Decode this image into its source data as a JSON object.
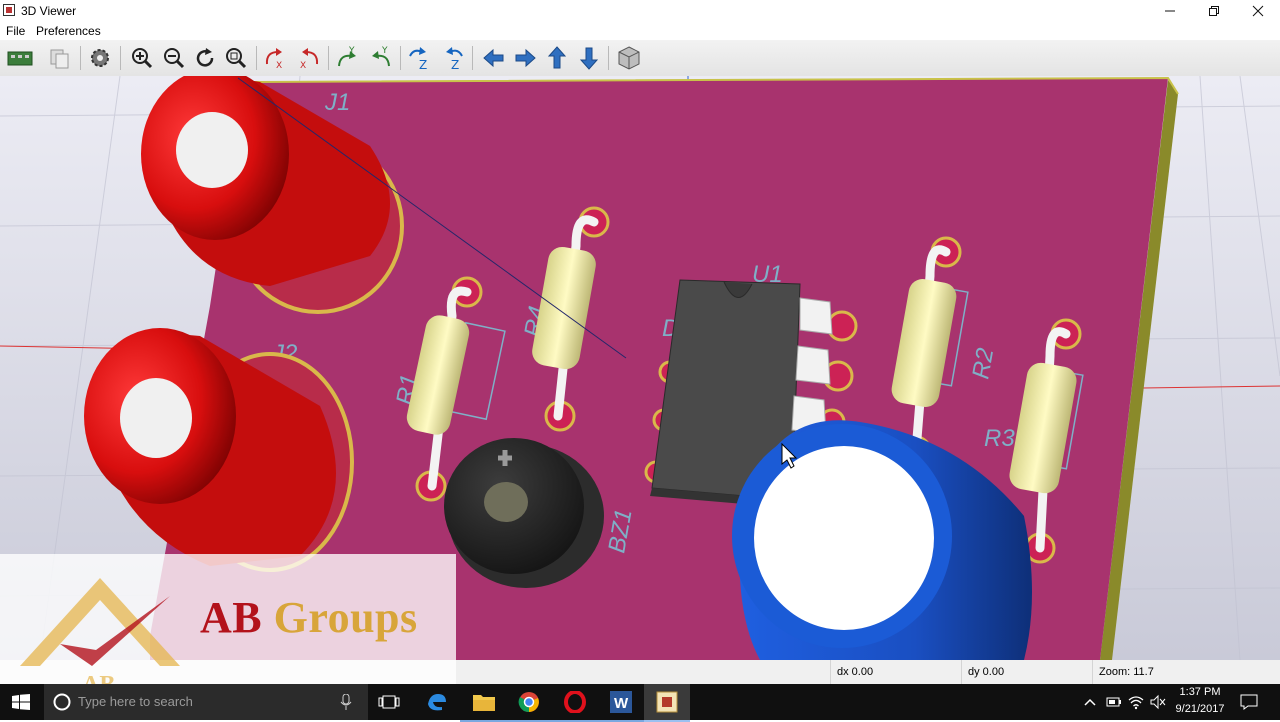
{
  "window": {
    "title": "3D Viewer"
  },
  "menu": {
    "items": [
      "File",
      "Preferences"
    ]
  },
  "toolbar": {
    "buttons": [
      "reload-board",
      "copy-to-clipboard",
      "settings",
      "zoom-in",
      "zoom-out",
      "redraw",
      "zoom-fit",
      "rotate-x-cw",
      "rotate-x-ccw",
      "rotate-y-cw",
      "rotate-y-ccw",
      "rotate-z-cw",
      "rotate-z-ccw",
      "pan-left",
      "pan-right",
      "pan-up",
      "pan-down",
      "orthographic-toggle"
    ],
    "axis_labels": {
      "x": "X",
      "y": "Y",
      "z": "Z"
    }
  },
  "board": {
    "color": "#a8336e",
    "labels": {
      "j1": "J1",
      "j2": "J2",
      "r1": "R1",
      "r2": "R2",
      "r3": "R3",
      "r4": "R4",
      "u1": "U1",
      "bz1": "BZ1",
      "d1": "D"
    }
  },
  "status": {
    "dx": "dx 0.00",
    "dy": "dy 0.00",
    "zoom": "Zoom: 11.7"
  },
  "watermark": {
    "text": "AB Groups",
    "logo_text": "AB",
    "color_ab": "#b3121b",
    "color_groups": "#d8a53a"
  },
  "taskbar": {
    "search_placeholder": "Type here to search",
    "time": "1:37 PM",
    "date": "9/21/2017",
    "pinned": [
      "file-explorer",
      "chrome",
      "opera",
      "word",
      "kicad"
    ]
  }
}
